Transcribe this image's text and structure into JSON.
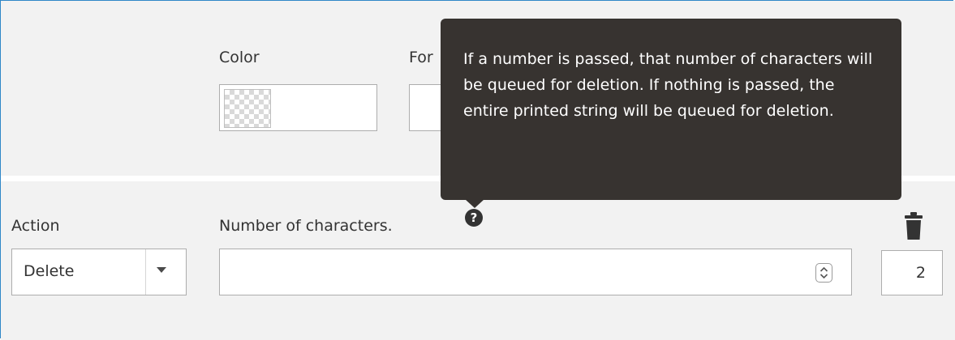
{
  "style_row": {
    "color_label": "Color",
    "font_label_partial": "For"
  },
  "action_row": {
    "action_label": "Action",
    "action_select_value": "Delete",
    "characters_label": "Number of characters.",
    "help_symbol": "?",
    "characters_value": "",
    "order_value": "2"
  },
  "tooltip": {
    "text": "If a number is passed, that number of characters will be queued for deletion. If nothing is passed, the entire printed string will be queued for deletion."
  },
  "icons": {
    "help": "question-circle-icon",
    "delete": "trash-icon",
    "spinner": "number-spinner-icon",
    "dropdown": "chevron-down-icon"
  },
  "colors": {
    "tooltip_bg": "#373330",
    "panel_bg": "#f2f2f2",
    "frame_border": "#2f87c8"
  }
}
